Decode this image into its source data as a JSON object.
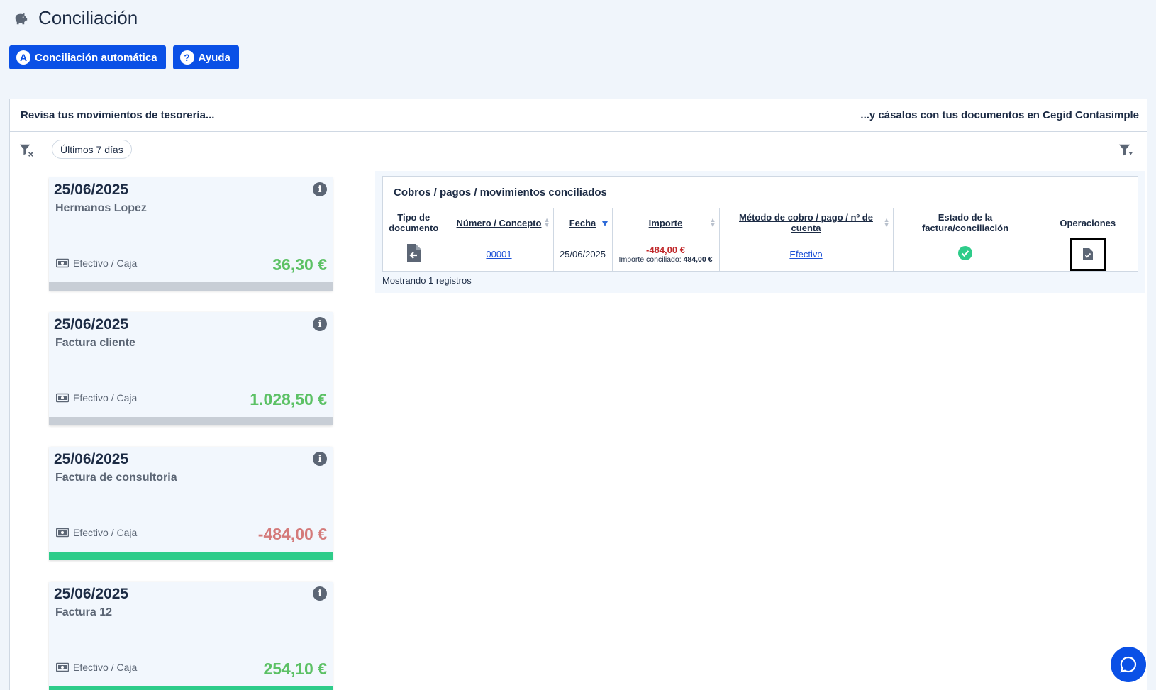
{
  "header": {
    "title": "Conciliación",
    "icon": "piggy-bank-icon"
  },
  "toolbar": {
    "auto_label": "Conciliación automática",
    "auto_icon_letter": "A",
    "help_label": "Ayuda",
    "help_icon_letter": "?"
  },
  "panel": {
    "left_title": "Revisa tus movimientos de tesorería...",
    "right_title": "...y cásalos con tus documentos en Cegid Contasimple",
    "filter_chip": "Últimos 7 días"
  },
  "cards": [
    {
      "date": "25/06/2025",
      "name": "Hermanos Lopez",
      "method": "Efectivo / Caja",
      "amount": "36,30 €",
      "sign": "pos",
      "bar_color": "#c8ced6"
    },
    {
      "date": "25/06/2025",
      "name": "Factura cliente",
      "method": "Efectivo / Caja",
      "amount": "1.028,50 €",
      "sign": "pos",
      "bar_color": "#c8ced6"
    },
    {
      "date": "25/06/2025",
      "name": "Factura de consultoria",
      "method": "Efectivo / Caja",
      "amount": "-484,00 €",
      "sign": "neg",
      "bar_color": "#2ecc8a"
    },
    {
      "date": "25/06/2025",
      "name": "Factura 12",
      "method": "Efectivo / Caja",
      "amount": "254,10 €",
      "sign": "pos",
      "bar_color": "#2ecc8a"
    }
  ],
  "table": {
    "title": "Cobros / pagos / movimientos conciliados",
    "columns": [
      "Tipo de documento",
      "Número / Concepto",
      "Fecha",
      "Importe",
      "Método de cobro / pago / nº de cuenta",
      "Estado de la factura/conciliación",
      "Operaciones"
    ],
    "rows": [
      {
        "numero": "00001",
        "fecha": "25/06/2025",
        "importe": "-484,00 €",
        "importe_conciliado_label": "Importe conciliado:",
        "importe_conciliado": "484,00 €",
        "metodo": "Efectivo"
      }
    ],
    "footer": "Mostrando 1 registros"
  }
}
